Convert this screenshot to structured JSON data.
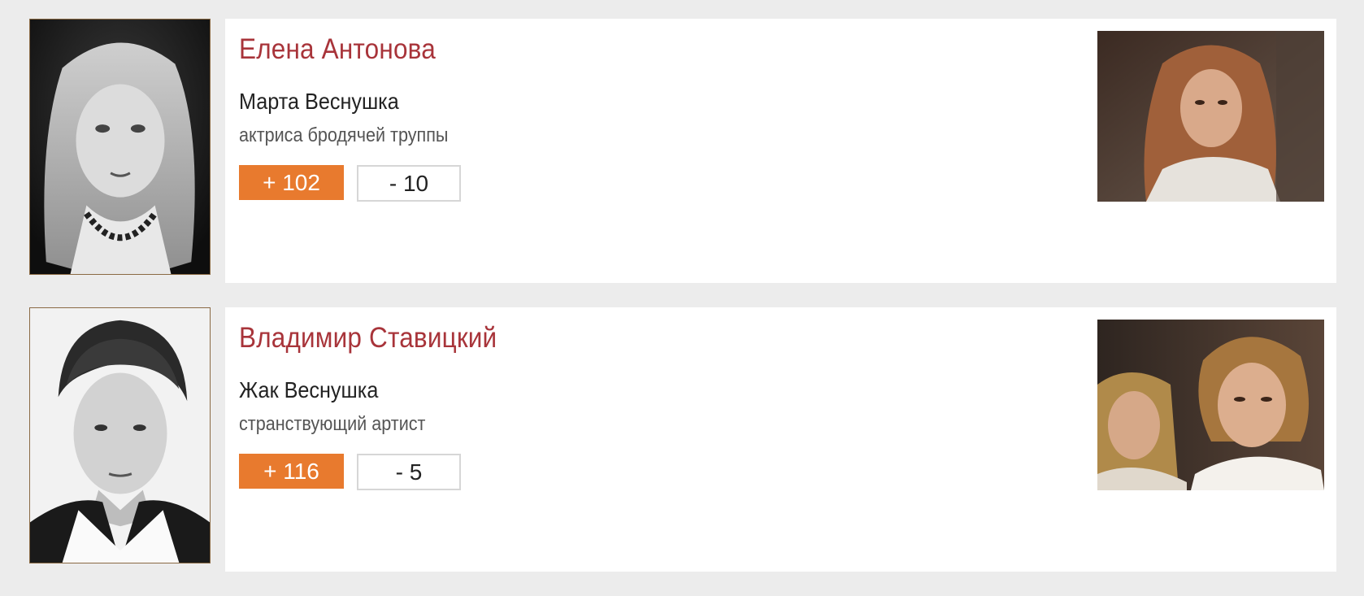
{
  "cast": [
    {
      "actor_name": "Елена Антонова",
      "role_name": "Марта Веснушка",
      "role_description": "актриса бродячей труппы",
      "votes_up": "+ 102",
      "votes_down": "- 10"
    },
    {
      "actor_name": "Владимир Ставицкий",
      "role_name": "Жак Веснушка",
      "role_description": "странствующий артист",
      "votes_up": "+ 116",
      "votes_down": "- 5"
    }
  ],
  "colors": {
    "page_background": "#ececec",
    "actor_name": "#a8343a",
    "vote_plus_background": "#e87a2e",
    "vote_minus_border": "#d6d6d6"
  }
}
